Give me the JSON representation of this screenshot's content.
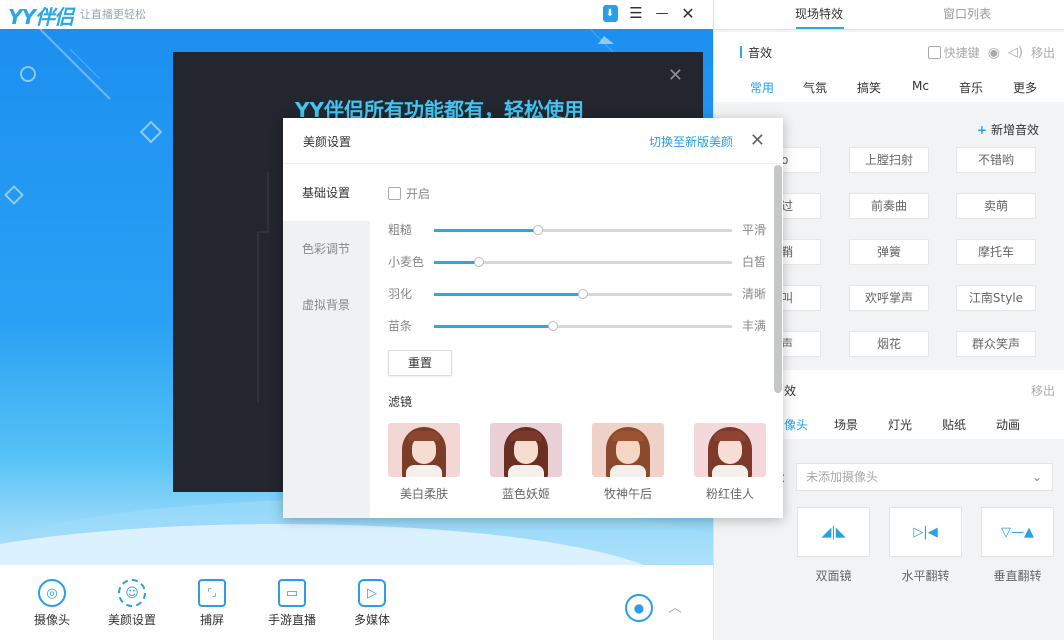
{
  "app": {
    "logo": "YY伴侣",
    "slogan": "让直播更轻松"
  },
  "window_controls": {
    "download_icon": "⬇",
    "menu_icon": "☰",
    "min_icon": "—",
    "close_icon": "✕"
  },
  "promo": {
    "title": "YY伴侣所有功能都有，轻松使用",
    "close_icon": "✕"
  },
  "bottom_toolbar": [
    {
      "label": "摄像头",
      "icon": "camera-icon",
      "glyph": "◎"
    },
    {
      "label": "美颜设置",
      "icon": "beauty-icon",
      "glyph": "☺"
    },
    {
      "label": "捕屏",
      "icon": "capture-icon",
      "glyph": "⌜⌟"
    },
    {
      "label": "手游直播",
      "icon": "mobile-icon",
      "glyph": "▭"
    },
    {
      "label": "多媒体",
      "icon": "media-icon",
      "glyph": "▷"
    }
  ],
  "record_icon": "●",
  "expand_icon": "︿",
  "beauty_dialog": {
    "title": "美颜设置",
    "switch_link": "切换至新版美颜",
    "close_icon": "✕",
    "nav": [
      "基础设置",
      "色彩调节",
      "虚拟背景"
    ],
    "enable_label": "开启",
    "sliders": [
      {
        "left": "粗糙",
        "right": "平滑",
        "value": 0.35
      },
      {
        "left": "小麦色",
        "right": "白皙",
        "value": 0.15
      },
      {
        "left": "羽化",
        "right": "清晰",
        "value": 0.5
      },
      {
        "left": "苗条",
        "right": "丰满",
        "value": 0.4
      }
    ],
    "reset_label": "重置",
    "filter_title": "滤镜",
    "filters": [
      "美白柔肤",
      "蓝色妖姬",
      "牧神午后",
      "粉红佳人"
    ]
  },
  "right_panel": {
    "tabs": [
      "现场特效",
      "窗口列表"
    ],
    "sfx_section": {
      "title": "音效",
      "hotkey_label": "快捷键",
      "remove_label": "移出",
      "categories": [
        "常用",
        "气氛",
        "搞笑",
        "Mc",
        "音乐",
        "更多"
      ],
      "add_label": "新增音效",
      "buttons": [
        [
          "no",
          "上膛扫射",
          "不错哟"
        ],
        [
          "飞过",
          "前奏曲",
          "卖萌"
        ],
        [
          "出鞘",
          "弹簧",
          "摩托车"
        ],
        [
          "尖叫",
          "欢呼掌声",
          "江南Style"
        ],
        [
          "掌声",
          "烟花",
          "群众笑声"
        ]
      ]
    },
    "fx_section": {
      "title": "效",
      "remove_label": "移出",
      "categories": [
        "像头",
        "场景",
        "灯光",
        "贴纸",
        "动画"
      ],
      "camera_prefix": "：",
      "camera_placeholder": "未添加摄像头",
      "mirrors": [
        {
          "label": "双面镜",
          "glyph": "◢|◣"
        },
        {
          "label": "水平翻转",
          "glyph": "▷|◀"
        },
        {
          "label": "垂直翻转",
          "glyph": "▽—▲"
        }
      ]
    }
  }
}
